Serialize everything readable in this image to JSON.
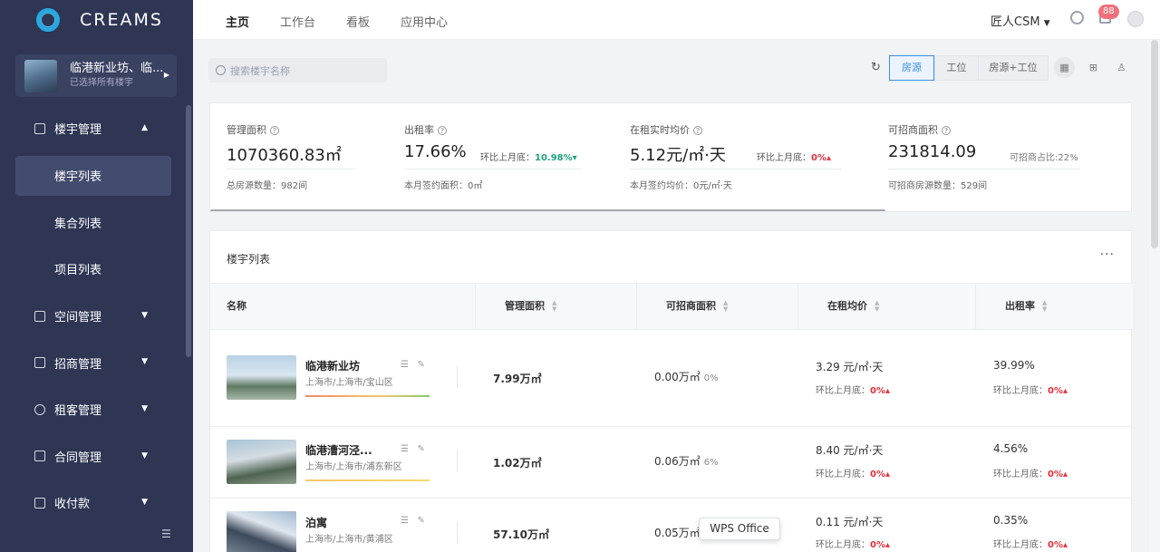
{
  "sidebar": {
    "logo_text": "CREAMS",
    "project": {
      "name": "临港新业坊、临...",
      "sub": "已选择所有楼宇"
    },
    "menu": [
      {
        "label": "楼宇管理",
        "expanded": true,
        "children": [
          "楼宇列表",
          "集合列表",
          "项目列表"
        ],
        "active_child": "楼宇列表"
      },
      {
        "label": "空间管理"
      },
      {
        "label": "招商管理"
      },
      {
        "label": "租客管理"
      },
      {
        "label": "合同管理"
      },
      {
        "label": "收付款"
      }
    ]
  },
  "topbar": {
    "tabs": [
      "主页",
      "工作台",
      "看板",
      "应用中心"
    ],
    "active_tab": "主页",
    "user": "匠人CSM",
    "notification_count": "88"
  },
  "toolbar": {
    "search_placeholder": "搜索楼宇名称",
    "segments": [
      "房源",
      "工位",
      "房源+工位"
    ],
    "active_segment": "房源"
  },
  "stats": {
    "mgmt_area": {
      "label": "管理面积",
      "value": "1070360.83㎡",
      "sub": "总房源数量：982间"
    },
    "occupancy": {
      "label": "出租率",
      "value": "17.66%",
      "cmp_label": "环比上月底：",
      "cmp_value": "10.98%",
      "sub": "本月签约面积：0㎡"
    },
    "avg_price": {
      "label": "在租实时均价",
      "value": "5.12元/㎡·天",
      "cmp_label": "环比上月底：",
      "cmp_value": "0%",
      "sub": "本月签约均价：0元/㎡·天"
    },
    "available": {
      "label": "可招商面积",
      "value": "231814.09",
      "extra": "可招商占比:22%",
      "sub": "可招商房源数量：529间"
    }
  },
  "table": {
    "title": "楼宇列表",
    "columns": [
      "名称",
      "管理面积",
      "可招商面积",
      "在租均价",
      "出租率"
    ],
    "compare_label": "环比上月底：",
    "rows": [
      {
        "name": "临港新业坊",
        "address": "上海市/上海市/宝山区",
        "mgmt_area": "7.99万㎡",
        "available": "0.00万㎡",
        "available_pct": "0%",
        "price": "3.29 元/㎡·天",
        "price_cmp": "0%",
        "rate": "39.99%",
        "rate_cmp": "0%"
      },
      {
        "name": "临港漕河泾...",
        "address": "上海市/上海市/浦东新区",
        "mgmt_area": "1.02万㎡",
        "available": "0.06万㎡",
        "available_pct": "6%",
        "price": "8.40 元/㎡·天",
        "price_cmp": "0%",
        "rate": "4.56%",
        "rate_cmp": "0%"
      },
      {
        "name": "泊寓",
        "address": "上海市/上海市/黄浦区",
        "mgmt_area": "57.10万㎡",
        "available": "0.05万㎡",
        "available_pct": "",
        "price": "0.11 元/㎡·天",
        "price_cmp": "0%",
        "rate": "0.35%",
        "rate_cmp": "0%"
      }
    ]
  },
  "tooltip": "WPS Office"
}
